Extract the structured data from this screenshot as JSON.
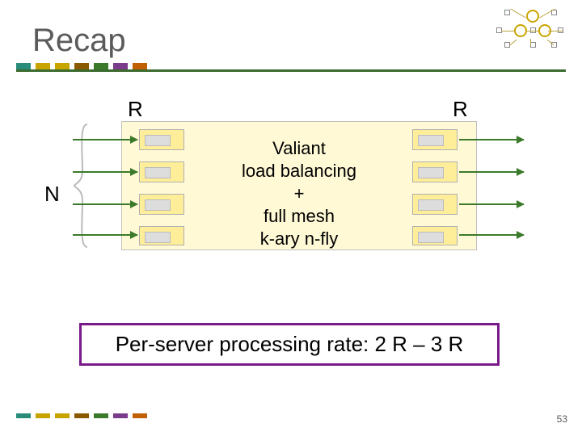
{
  "title": "Recap",
  "labels": {
    "N": "N",
    "R_left": "R",
    "R_right": "R"
  },
  "center_text": {
    "l1": "Valiant",
    "l2": "load balancing",
    "l3": "+",
    "l4": "full mesh",
    "l5": "k-ary n-fly"
  },
  "formula": "Per-server processing rate: 2 R – 3 R",
  "page_number": "53",
  "bar_colors": [
    "t-teal",
    "t-olive",
    "t-brown",
    "t-green",
    "t-purple",
    "t-orange"
  ]
}
